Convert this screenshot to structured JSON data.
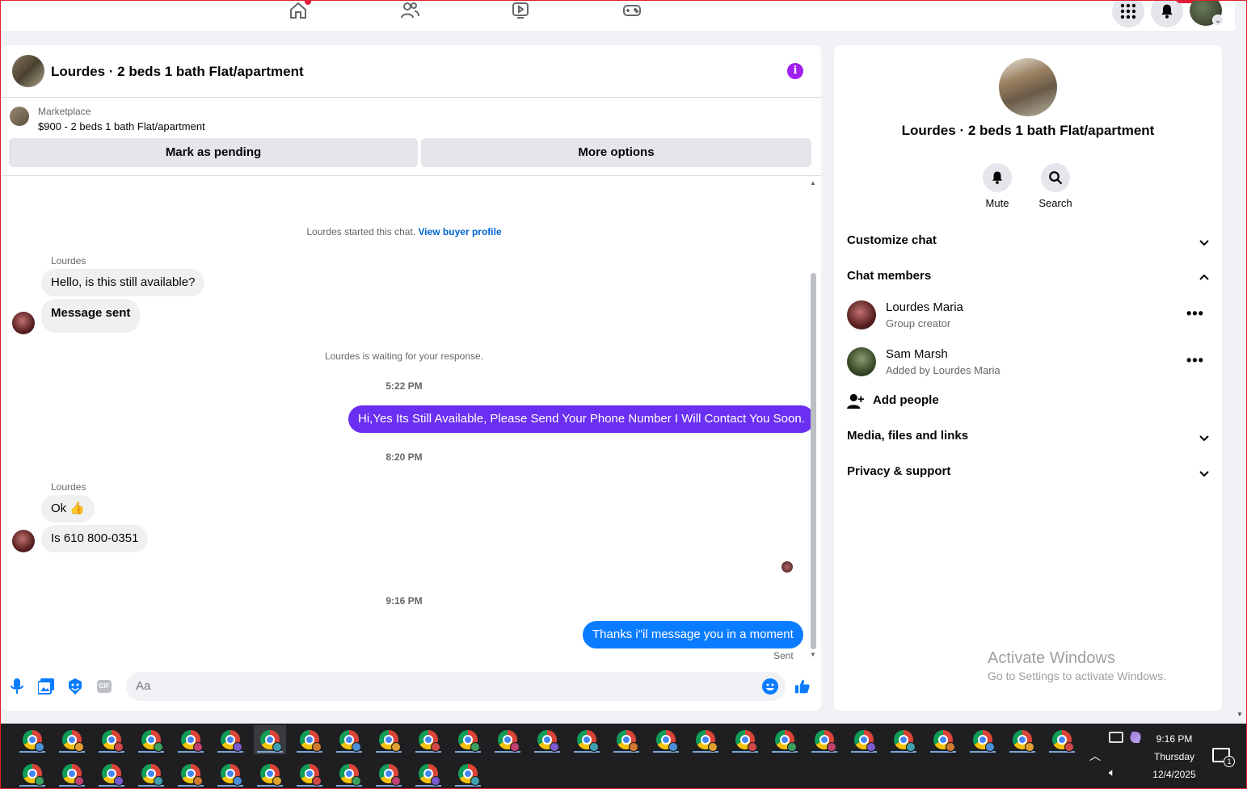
{
  "topnav": {
    "icons": [
      "home-icon",
      "friends-icon",
      "watch-icon",
      "gaming-icon"
    ],
    "right_icons": [
      "menu-grid-icon",
      "bell-icon",
      "profile-avatar"
    ]
  },
  "chat": {
    "title": "Lourdes · 2 beds 1 bath Flat/apartment",
    "marketplace_label": "Marketplace",
    "listing": "$900 - 2 beds 1 bath Flat/apartment",
    "mark_pending": "Mark as pending",
    "more_options": "More options",
    "started_text": "Lourdes started this chat.",
    "view_profile": "View buyer profile",
    "sender1": "Lourdes",
    "msg1": "Hello, is this still available?",
    "msg2": "Message sent",
    "waiting": "Lourdes is waiting for your response.",
    "time1": "5:22 PM",
    "reply1": "Hi,Yes Its Still Available, Please Send Your Phone Number I Will Contact You Soon.",
    "time2": "8:20 PM",
    "sender2": "Lourdes",
    "msg3": "Ok 👍",
    "msg4": "Is 610 800-0351",
    "time3": "9:16 PM",
    "reply2": "Thanks i\"il message you in a moment",
    "sent_status": "Sent",
    "composer_placeholder": "Aa",
    "colors": {
      "outgoing_purple": "#6a2ff0",
      "outgoing_blue": "#0a7cff",
      "accent": "#0064d1"
    }
  },
  "side": {
    "title": "Lourdes · 2 beds 1 bath Flat/apartment",
    "mute": "Mute",
    "search": "Search",
    "customize": "Customize chat",
    "members_header": "Chat members",
    "members": [
      {
        "name": "Lourdes Maria",
        "sub": "Group creator"
      },
      {
        "name": "Sam Marsh",
        "sub": "Added by Lourdes Maria"
      }
    ],
    "add_people": "Add people",
    "media": "Media, files and links",
    "privacy": "Privacy & support"
  },
  "watermark": {
    "line1": "Activate Windows",
    "line2": "Go to Settings to activate Windows."
  },
  "taskbar": {
    "time": "9:16 PM",
    "day": "Thursday",
    "date": "12/4/2025",
    "notif_count": "1"
  }
}
